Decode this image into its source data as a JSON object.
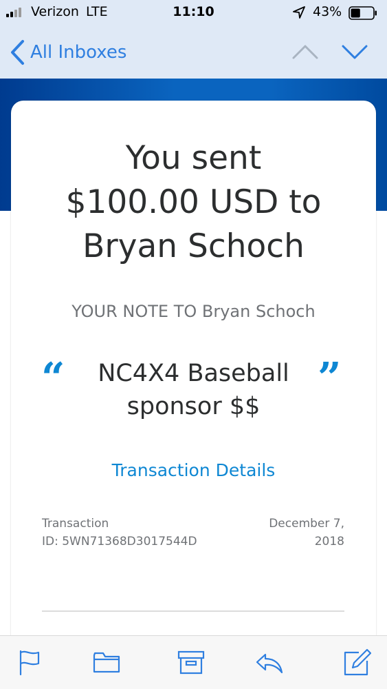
{
  "status_bar": {
    "carrier": "Verizon",
    "network": "LTE",
    "time": "11:10",
    "battery_percent": "43%",
    "battery_level": 0.43,
    "icons": [
      "signal-icon",
      "location-arrow-icon",
      "battery-icon"
    ]
  },
  "nav": {
    "back_label": "All Inboxes",
    "icons": [
      "chevron-left-icon",
      "chevron-up-icon",
      "chevron-down-icon"
    ]
  },
  "email": {
    "headline_line1": "You sent",
    "headline_line2": "$100.00 USD to",
    "headline_line3": "Bryan Schoch",
    "note_label": "YOUR NOTE TO Bryan Schoch",
    "quote_open": "“",
    "quote_close": "”",
    "note_line1": "NC4X4 Baseball",
    "note_line2": "sponsor $$",
    "transaction_link": "Transaction Details",
    "transaction_id_line1": "Transaction",
    "transaction_id_line2": "ID: 5WN71368D3017544D",
    "date_line1": "December 7,",
    "date_line2": "2018"
  },
  "toolbar": {
    "icons": [
      "flag-icon",
      "folder-icon",
      "archive-icon",
      "reply-icon",
      "compose-icon"
    ]
  },
  "colors": {
    "accent": "#2f7fe0",
    "link": "#0e87d3",
    "banner": "#0a64bf",
    "text": "#2c2e2f",
    "muted": "#6f7276"
  }
}
